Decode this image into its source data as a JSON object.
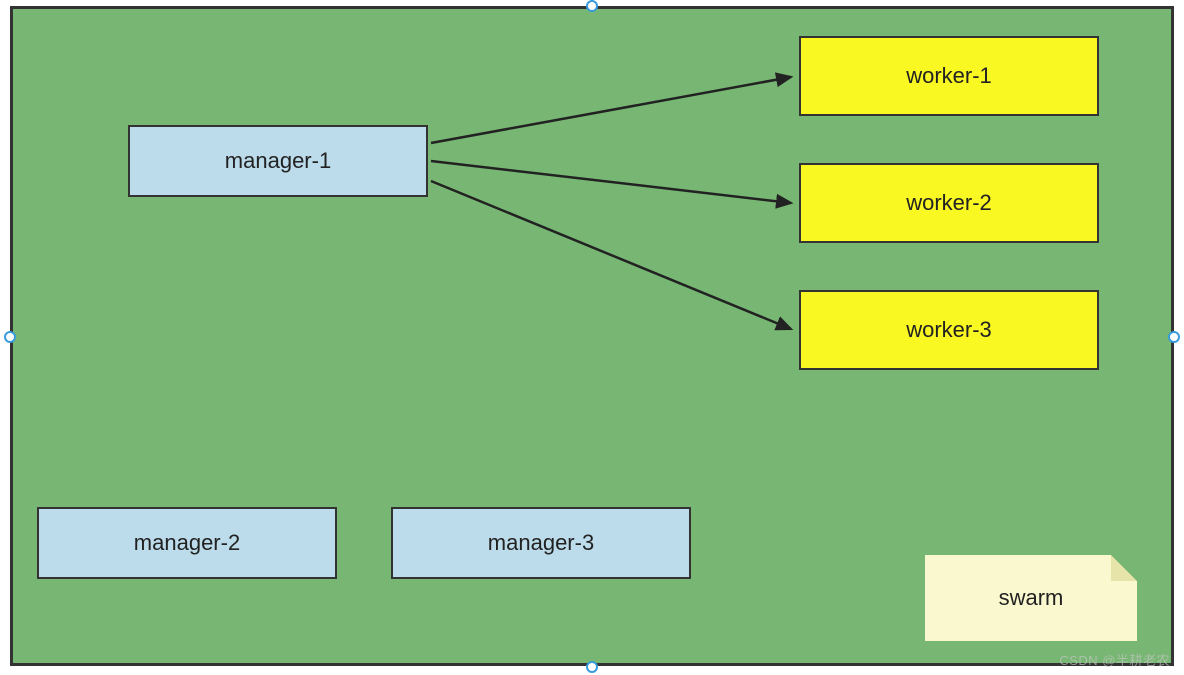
{
  "nodes": {
    "manager1": {
      "label": "manager-1"
    },
    "manager2": {
      "label": "manager-2"
    },
    "manager3": {
      "label": "manager-3"
    },
    "worker1": {
      "label": "worker-1"
    },
    "worker2": {
      "label": "worker-2"
    },
    "worker3": {
      "label": "worker-3"
    }
  },
  "note": {
    "label": "swarm"
  },
  "watermark": "CSDN @半耕老农",
  "colors": {
    "canvas": "#77b773",
    "manager": "#bddceb",
    "worker": "#faf823",
    "note": "#f9f8cf",
    "border": "#333333"
  },
  "diagram": {
    "type": "architecture",
    "title": "swarm",
    "edges": [
      {
        "from": "manager-1",
        "to": "worker-1"
      },
      {
        "from": "manager-1",
        "to": "worker-2"
      },
      {
        "from": "manager-1",
        "to": "worker-3"
      }
    ]
  }
}
